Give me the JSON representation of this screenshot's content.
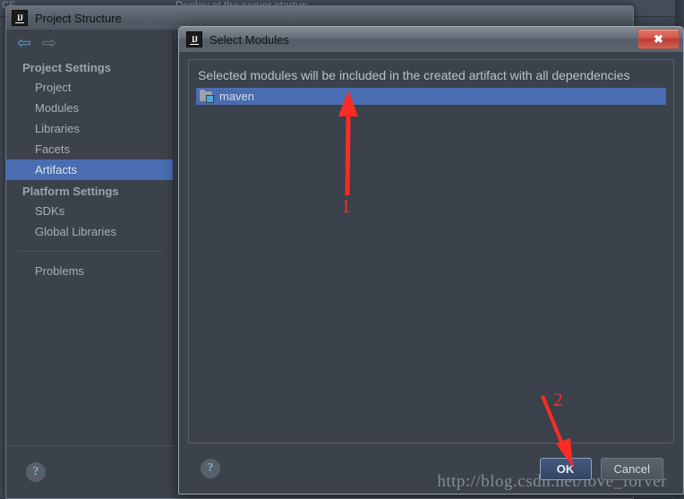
{
  "ide": {
    "ghost_text": "Deploy at the server startup",
    "left_ghost": "CE"
  },
  "project_structure": {
    "title": "Project Structure",
    "app_icon": "IJ",
    "nav": {
      "back_icon": "back-arrow-icon",
      "forward_icon": "forward-arrow-icon",
      "back_glyph": "⇦",
      "forward_glyph": "⇨"
    },
    "sidebar": {
      "groups": [
        {
          "label": "Project Settings",
          "items": [
            {
              "label": "Project",
              "selected": false
            },
            {
              "label": "Modules",
              "selected": false
            },
            {
              "label": "Libraries",
              "selected": false
            },
            {
              "label": "Facets",
              "selected": false
            },
            {
              "label": "Artifacts",
              "selected": true
            }
          ]
        },
        {
          "label": "Platform Settings",
          "items": [
            {
              "label": "SDKs",
              "selected": false
            },
            {
              "label": "Global Libraries",
              "selected": false
            }
          ]
        }
      ],
      "extra_items": [
        {
          "label": "Problems",
          "selected": false
        }
      ]
    },
    "help_glyph": "?"
  },
  "select_modules_dialog": {
    "title": "Select Modules",
    "app_icon": "IJ",
    "close_glyph": "✖",
    "description": "Selected modules will be included in the created artifact with all dependencies",
    "modules": [
      {
        "label": "maven",
        "selected": true,
        "icon": "module-folder-icon"
      }
    ],
    "help_glyph": "?",
    "buttons": {
      "ok": "OK",
      "cancel": "Cancel"
    }
  },
  "watermark": {
    "text": "http://blog.csdn.net/love_forver"
  },
  "annotations": [
    {
      "number": "1"
    },
    {
      "number": "2"
    }
  ],
  "colors": {
    "selection_blue": "#4a6cb0",
    "annotation_red": "#fe2b25",
    "window_bg": "#3c424b",
    "close_red": "#bb3b31"
  }
}
